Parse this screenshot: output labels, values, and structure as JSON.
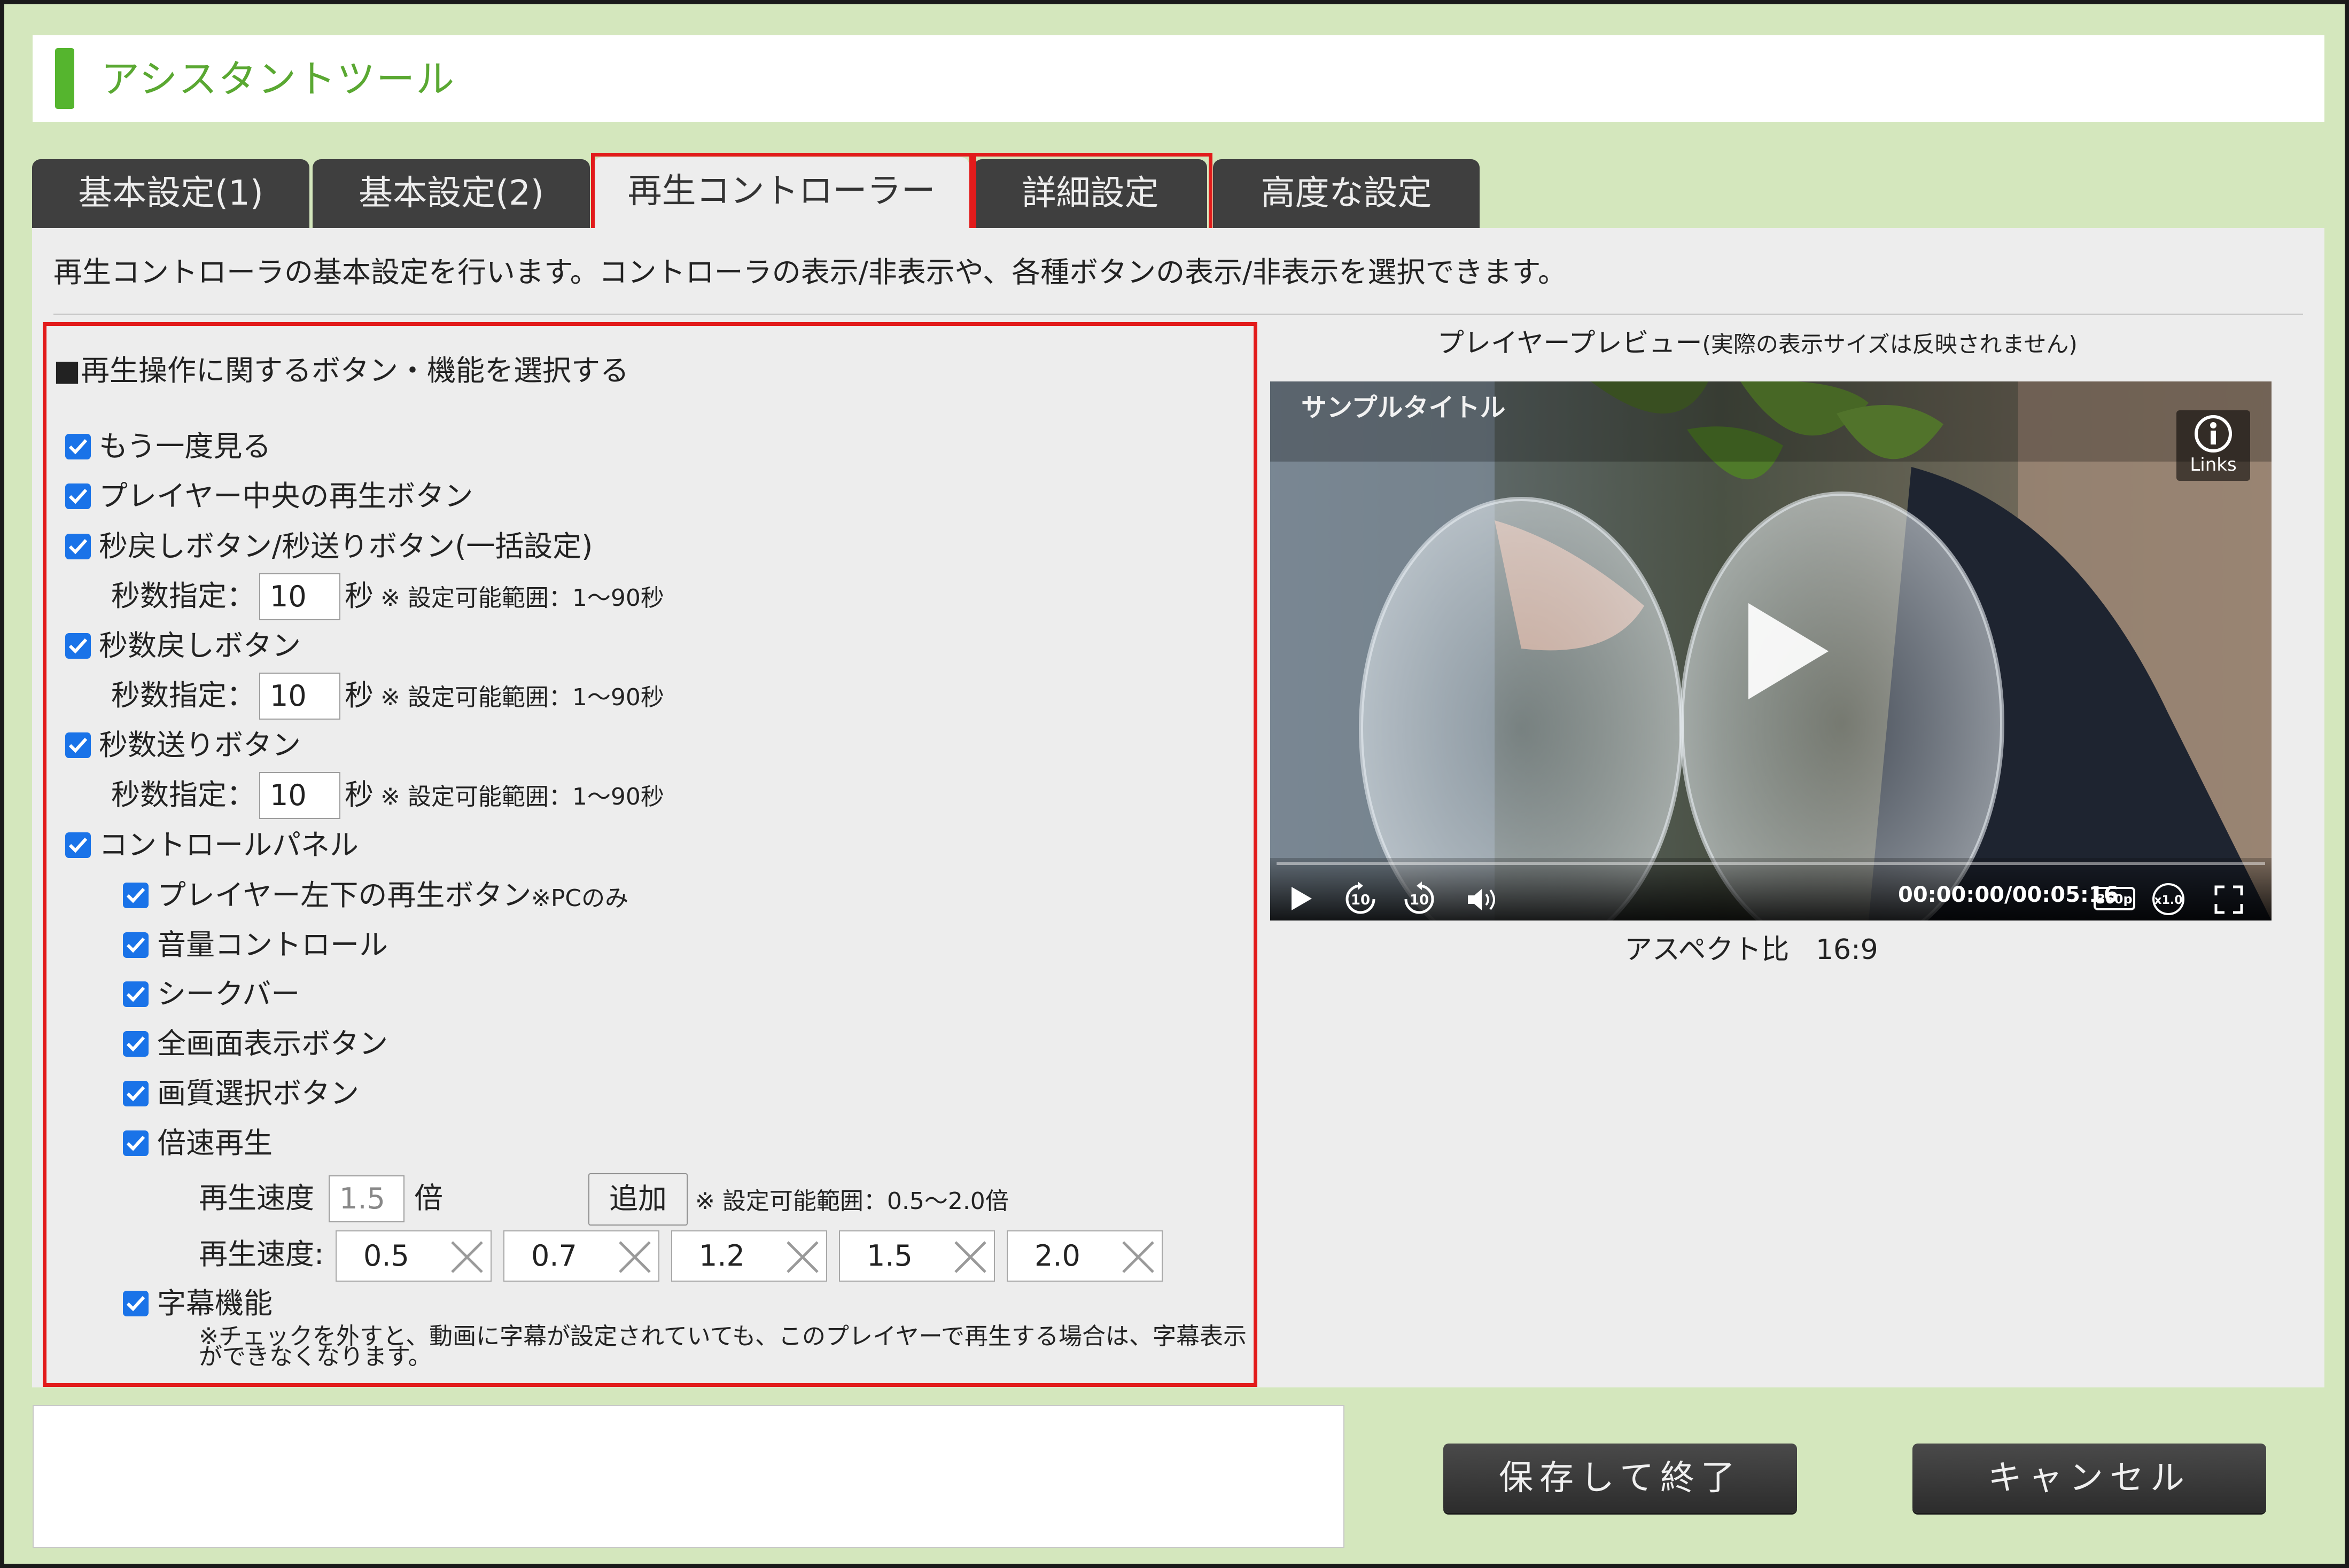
{
  "header": {
    "title": "アシスタントツール"
  },
  "tabs": [
    {
      "label": "基本設定(1)"
    },
    {
      "label": "基本設定(2)"
    },
    {
      "label": "再生コントローラー"
    },
    {
      "label": "詳細設定"
    },
    {
      "label": "高度な設定"
    }
  ],
  "description": "再生コントローラの基本設定を行います。コントローラの表示/非表示や、各種ボタンの表示/非表示を選択できます。",
  "section_title": "■再生操作に関するボタン・機能を選択する",
  "options": {
    "replay": "もう一度見る",
    "center_play": "プレイヤー中央の再生ボタン",
    "skip_both": "秒戻しボタン/秒送りボタン(一括設定)",
    "skip_back": "秒数戻しボタン",
    "skip_forward": "秒数送りボタン",
    "control_panel": "コントロールパネル",
    "bottom_left_play": "プレイヤー左下の再生ボタン",
    "bottom_left_play_note": "※PCのみ",
    "volume": "音量コントロール",
    "seekbar": "シークバー",
    "fullscreen": "全画面表示ボタン",
    "quality": "画質選択ボタン",
    "speed": "倍速再生",
    "subtitles": "字幕機能",
    "subtitles_note_1": "※チェックを外すと、動画に字幕が設定されていても、このプレイヤーで再生する場合は、字幕表示",
    "subtitles_note_2": "ができなくなります。"
  },
  "seconds": {
    "label": "秒数指定：",
    "unit": "秒",
    "range_note": "※ 設定可能範囲：1～90秒",
    "skip_both_value": "10",
    "skip_back_value": "10",
    "skip_forward_value": "10"
  },
  "speed": {
    "input_label": "再生速度",
    "input_value": "1.5",
    "unit": "倍",
    "add_label": "追加",
    "range_note": "※ 設定可能範囲：0.5～2.0倍",
    "list_label": "再生速度:",
    "values": [
      "0.5",
      "0.7",
      "1.2",
      "1.5",
      "2.0"
    ]
  },
  "preview": {
    "title": "プレイヤープレビュー",
    "title_note": "(実際の表示サイズは反映されません)",
    "video_title": "サンプルタイトル",
    "links_label": "Links",
    "timecode": "00:00:00/00:05:16",
    "quality_badge": "360p",
    "speed_badge": "x1.0",
    "skip_back_badge": "10",
    "skip_forward_badge": "10",
    "aspect_label": "アスペクト比",
    "aspect_value": "16:9"
  },
  "buttons": {
    "save": "保存して終了",
    "cancel": "キャンセル"
  },
  "colors": {
    "accent_green": "#55b52e",
    "background_green": "#d4e7bd",
    "highlight_red": "#e21b1b",
    "checkbox_blue": "#1a73e8"
  }
}
